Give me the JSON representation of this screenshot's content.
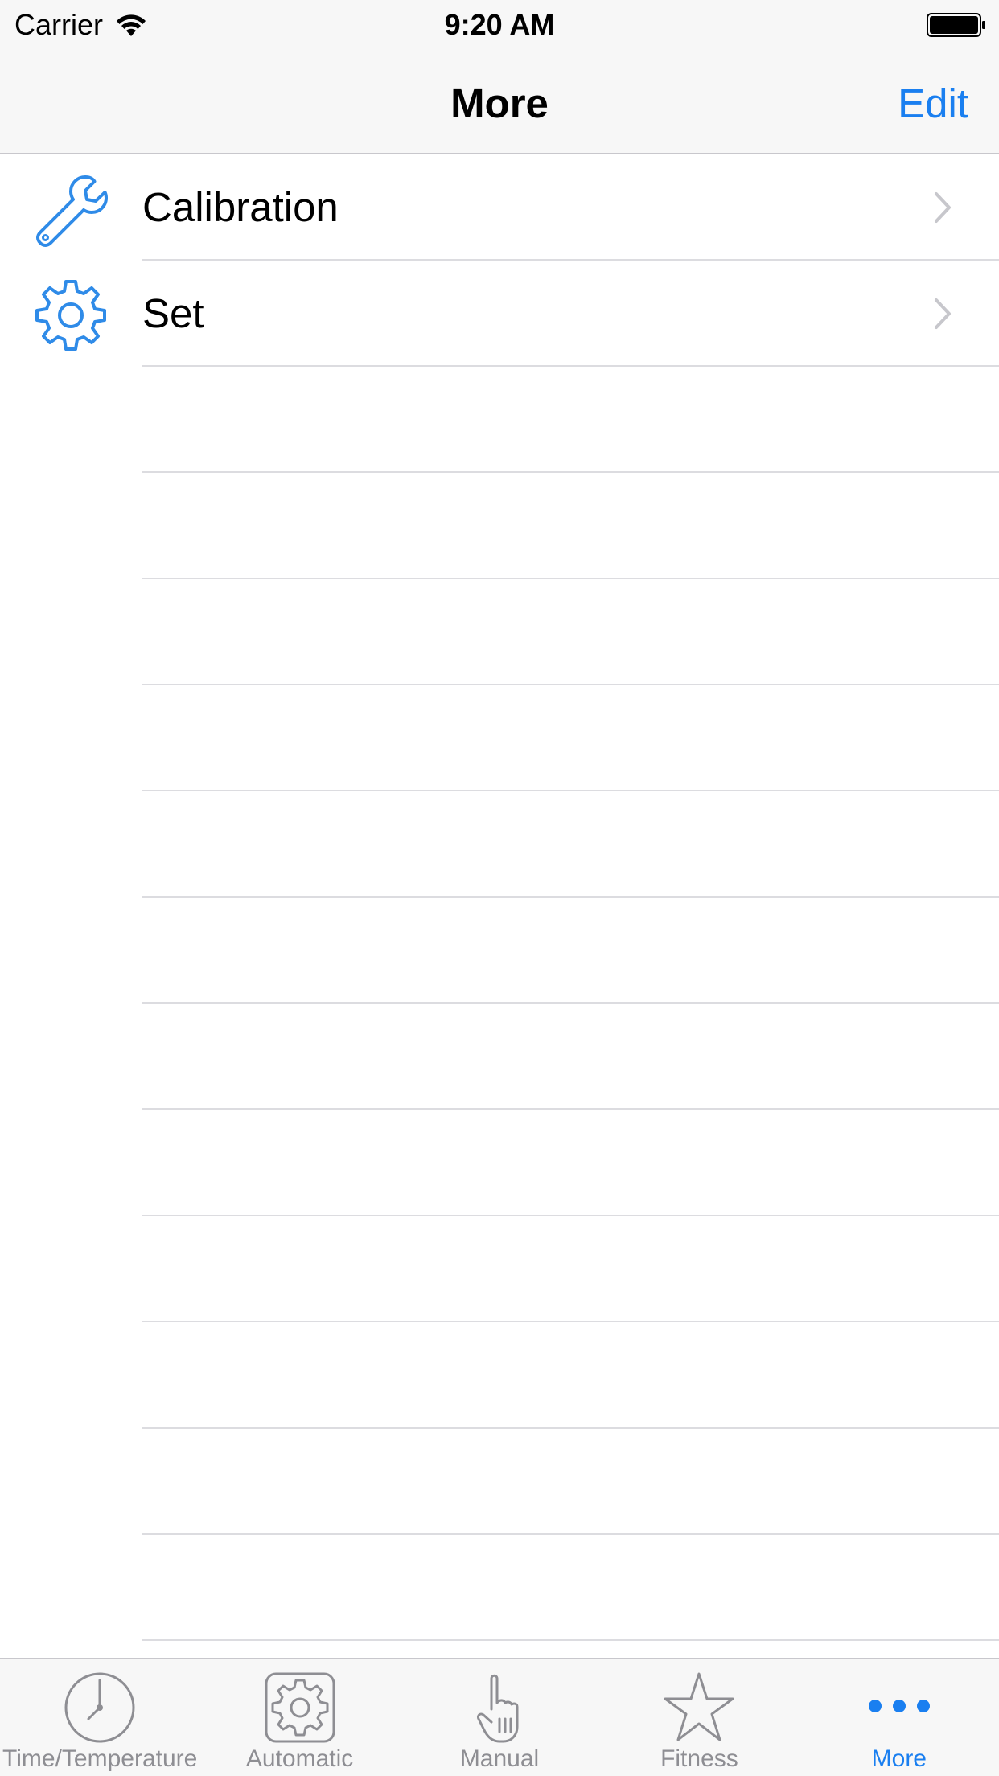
{
  "status_bar": {
    "carrier": "Carrier",
    "time": "9:20 AM",
    "icons": [
      "wifi-icon",
      "battery-icon"
    ]
  },
  "nav_bar": {
    "title": "More",
    "edit_label": "Edit"
  },
  "list": {
    "items": [
      {
        "label": "Calibration",
        "icon": "wrench-icon"
      },
      {
        "label": "Set",
        "icon": "gear-icon"
      }
    ]
  },
  "tab_bar": {
    "tabs": [
      {
        "label": "Time/Temperature",
        "icon": "clock-icon",
        "active": false
      },
      {
        "label": "Automatic",
        "icon": "automatic-gear-icon",
        "active": false
      },
      {
        "label": "Manual",
        "icon": "hand-icon",
        "active": false
      },
      {
        "label": "Fitness",
        "icon": "star-icon",
        "active": false
      },
      {
        "label": "More",
        "icon": "more-dots-icon",
        "active": true
      }
    ]
  },
  "colors": {
    "accent": "#1a7ff0",
    "icon_blue": "#2f8be8",
    "inactive_tab": "#8e8e93",
    "bar_background": "#f7f7f7",
    "separator": "#dcdce0"
  }
}
